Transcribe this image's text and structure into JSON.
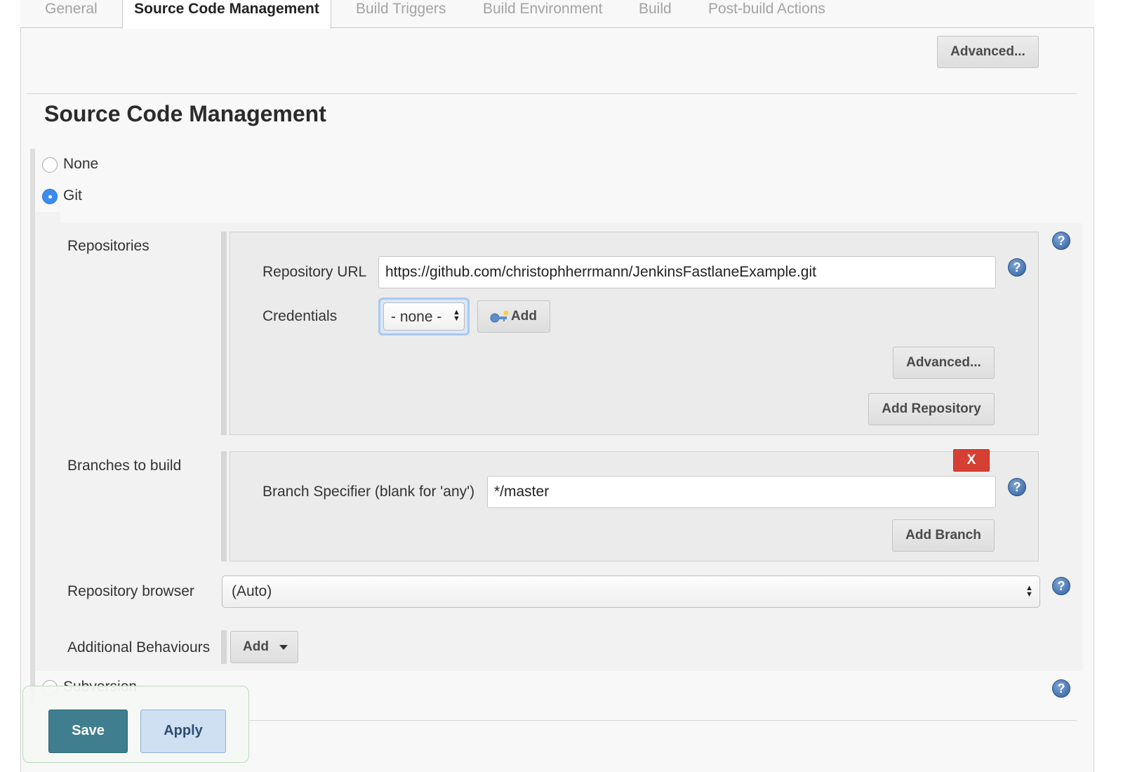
{
  "tabs": [
    {
      "label": "General"
    },
    {
      "label": "Source Code Management"
    },
    {
      "label": "Build Triggers"
    },
    {
      "label": "Build Environment"
    },
    {
      "label": "Build"
    },
    {
      "label": "Post-build Actions"
    }
  ],
  "top_advanced_label": "Advanced...",
  "section_title": "Source Code Management",
  "scm_options": {
    "none": "None",
    "git": "Git",
    "subversion": "Subversion",
    "selected": "Git"
  },
  "git": {
    "repositories_label": "Repositories",
    "repo_url_label": "Repository URL",
    "repo_url_value": "https://github.com/christophherrmann/JenkinsFastlaneExample.git",
    "credentials_label": "Credentials",
    "credentials_value": "- none -",
    "credentials_add_label": "Add",
    "repo_advanced_label": "Advanced...",
    "add_repository_label": "Add Repository",
    "branches_label": "Branches to build",
    "branch_delete_label": "X",
    "branch_specifier_label": "Branch Specifier (blank for 'any')",
    "branch_specifier_value": "*/master",
    "add_branch_label": "Add Branch",
    "repo_browser_label": "Repository browser",
    "repo_browser_value": "(Auto)",
    "additional_behaviours_label": "Additional Behaviours",
    "additional_add_label": "Add"
  },
  "help_glyph": "?",
  "footer": {
    "save_label": "Save",
    "apply_label": "Apply"
  },
  "colors": {
    "accent_blue": "#3b8cf0",
    "delete_red": "#d64034",
    "save_teal": "#3f7e8e",
    "apply_light_blue": "#cfe0f2"
  }
}
